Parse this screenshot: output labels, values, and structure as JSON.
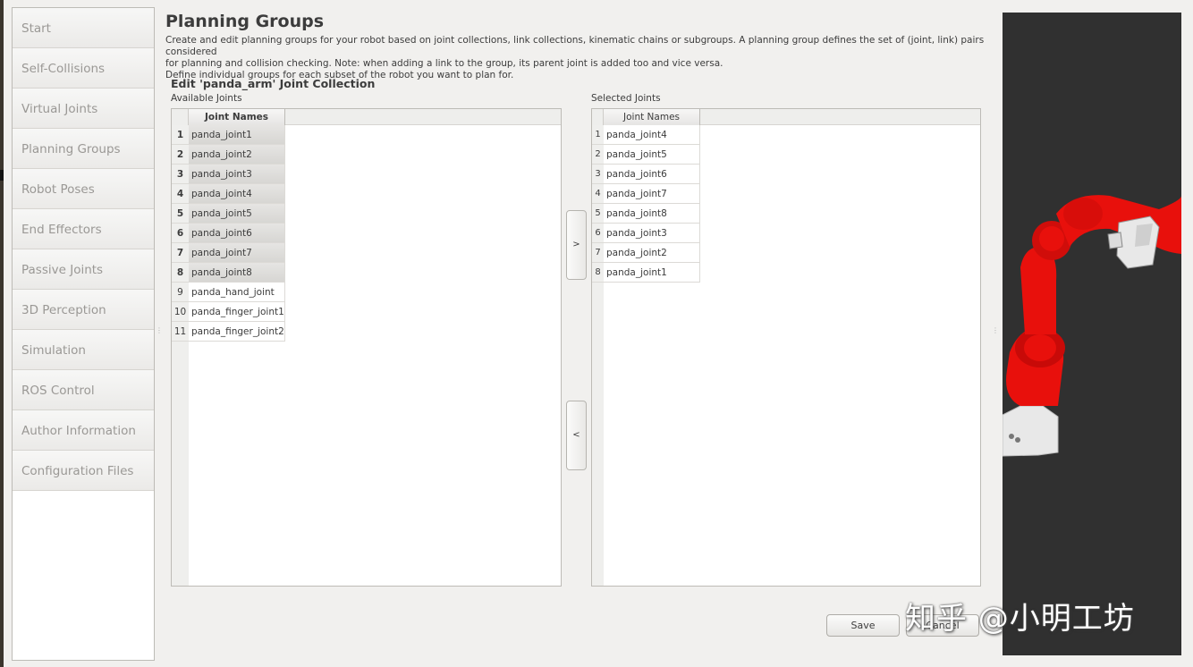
{
  "nav": {
    "items": [
      {
        "label": "Start"
      },
      {
        "label": "Self-Collisions"
      },
      {
        "label": "Virtual Joints"
      },
      {
        "label": "Planning Groups"
      },
      {
        "label": "Robot Poses"
      },
      {
        "label": "End Effectors"
      },
      {
        "label": "Passive Joints"
      },
      {
        "label": "3D Perception"
      },
      {
        "label": "Simulation"
      },
      {
        "label": "ROS Control"
      },
      {
        "label": "Author Information"
      },
      {
        "label": "Configuration Files"
      }
    ]
  },
  "header": {
    "title": "Planning Groups",
    "description_line1": "Create and edit planning groups for your robot based on joint collections, link collections, kinematic chains or subgroups. A planning group defines the set of (joint, link) pairs considered",
    "description_line2": "for planning and collision checking. Note: when adding a link to the group, its parent joint is added too and vice versa.",
    "description_line3": "Define individual groups for each subset of the robot you want to plan for."
  },
  "editor": {
    "title": "Edit 'panda_arm' Joint Collection",
    "available_label": "Available Joints",
    "selected_label": "Selected Joints",
    "column_header": "Joint Names",
    "move_right_label": ">",
    "move_left_label": "<"
  },
  "available_joints": [
    {
      "num": "1",
      "name": "panda_joint1"
    },
    {
      "num": "2",
      "name": "panda_joint2"
    },
    {
      "num": "3",
      "name": "panda_joint3"
    },
    {
      "num": "4",
      "name": "panda_joint4"
    },
    {
      "num": "5",
      "name": "panda_joint5"
    },
    {
      "num": "6",
      "name": "panda_joint6"
    },
    {
      "num": "7",
      "name": "panda_joint7"
    },
    {
      "num": "8",
      "name": "panda_joint8"
    },
    {
      "num": "9",
      "name": "panda_hand_joint"
    },
    {
      "num": "10",
      "name": "panda_finger_joint1"
    },
    {
      "num": "11",
      "name": "panda_finger_joint2"
    }
  ],
  "selected_joints": [
    {
      "num": "1",
      "name": "panda_joint4"
    },
    {
      "num": "2",
      "name": "panda_joint5"
    },
    {
      "num": "3",
      "name": "panda_joint6"
    },
    {
      "num": "4",
      "name": "panda_joint7"
    },
    {
      "num": "5",
      "name": "panda_joint8"
    },
    {
      "num": "6",
      "name": "panda_joint3"
    },
    {
      "num": "7",
      "name": "panda_joint2"
    },
    {
      "num": "8",
      "name": "panda_joint1"
    }
  ],
  "buttons": {
    "save": "Save",
    "cancel": "Cancel"
  },
  "watermark": "知乎 @小明工坊",
  "colors": {
    "robot_link": "#e8100c",
    "robot_gripper": "#e8e8e8",
    "viewport_bg": "#303030"
  }
}
